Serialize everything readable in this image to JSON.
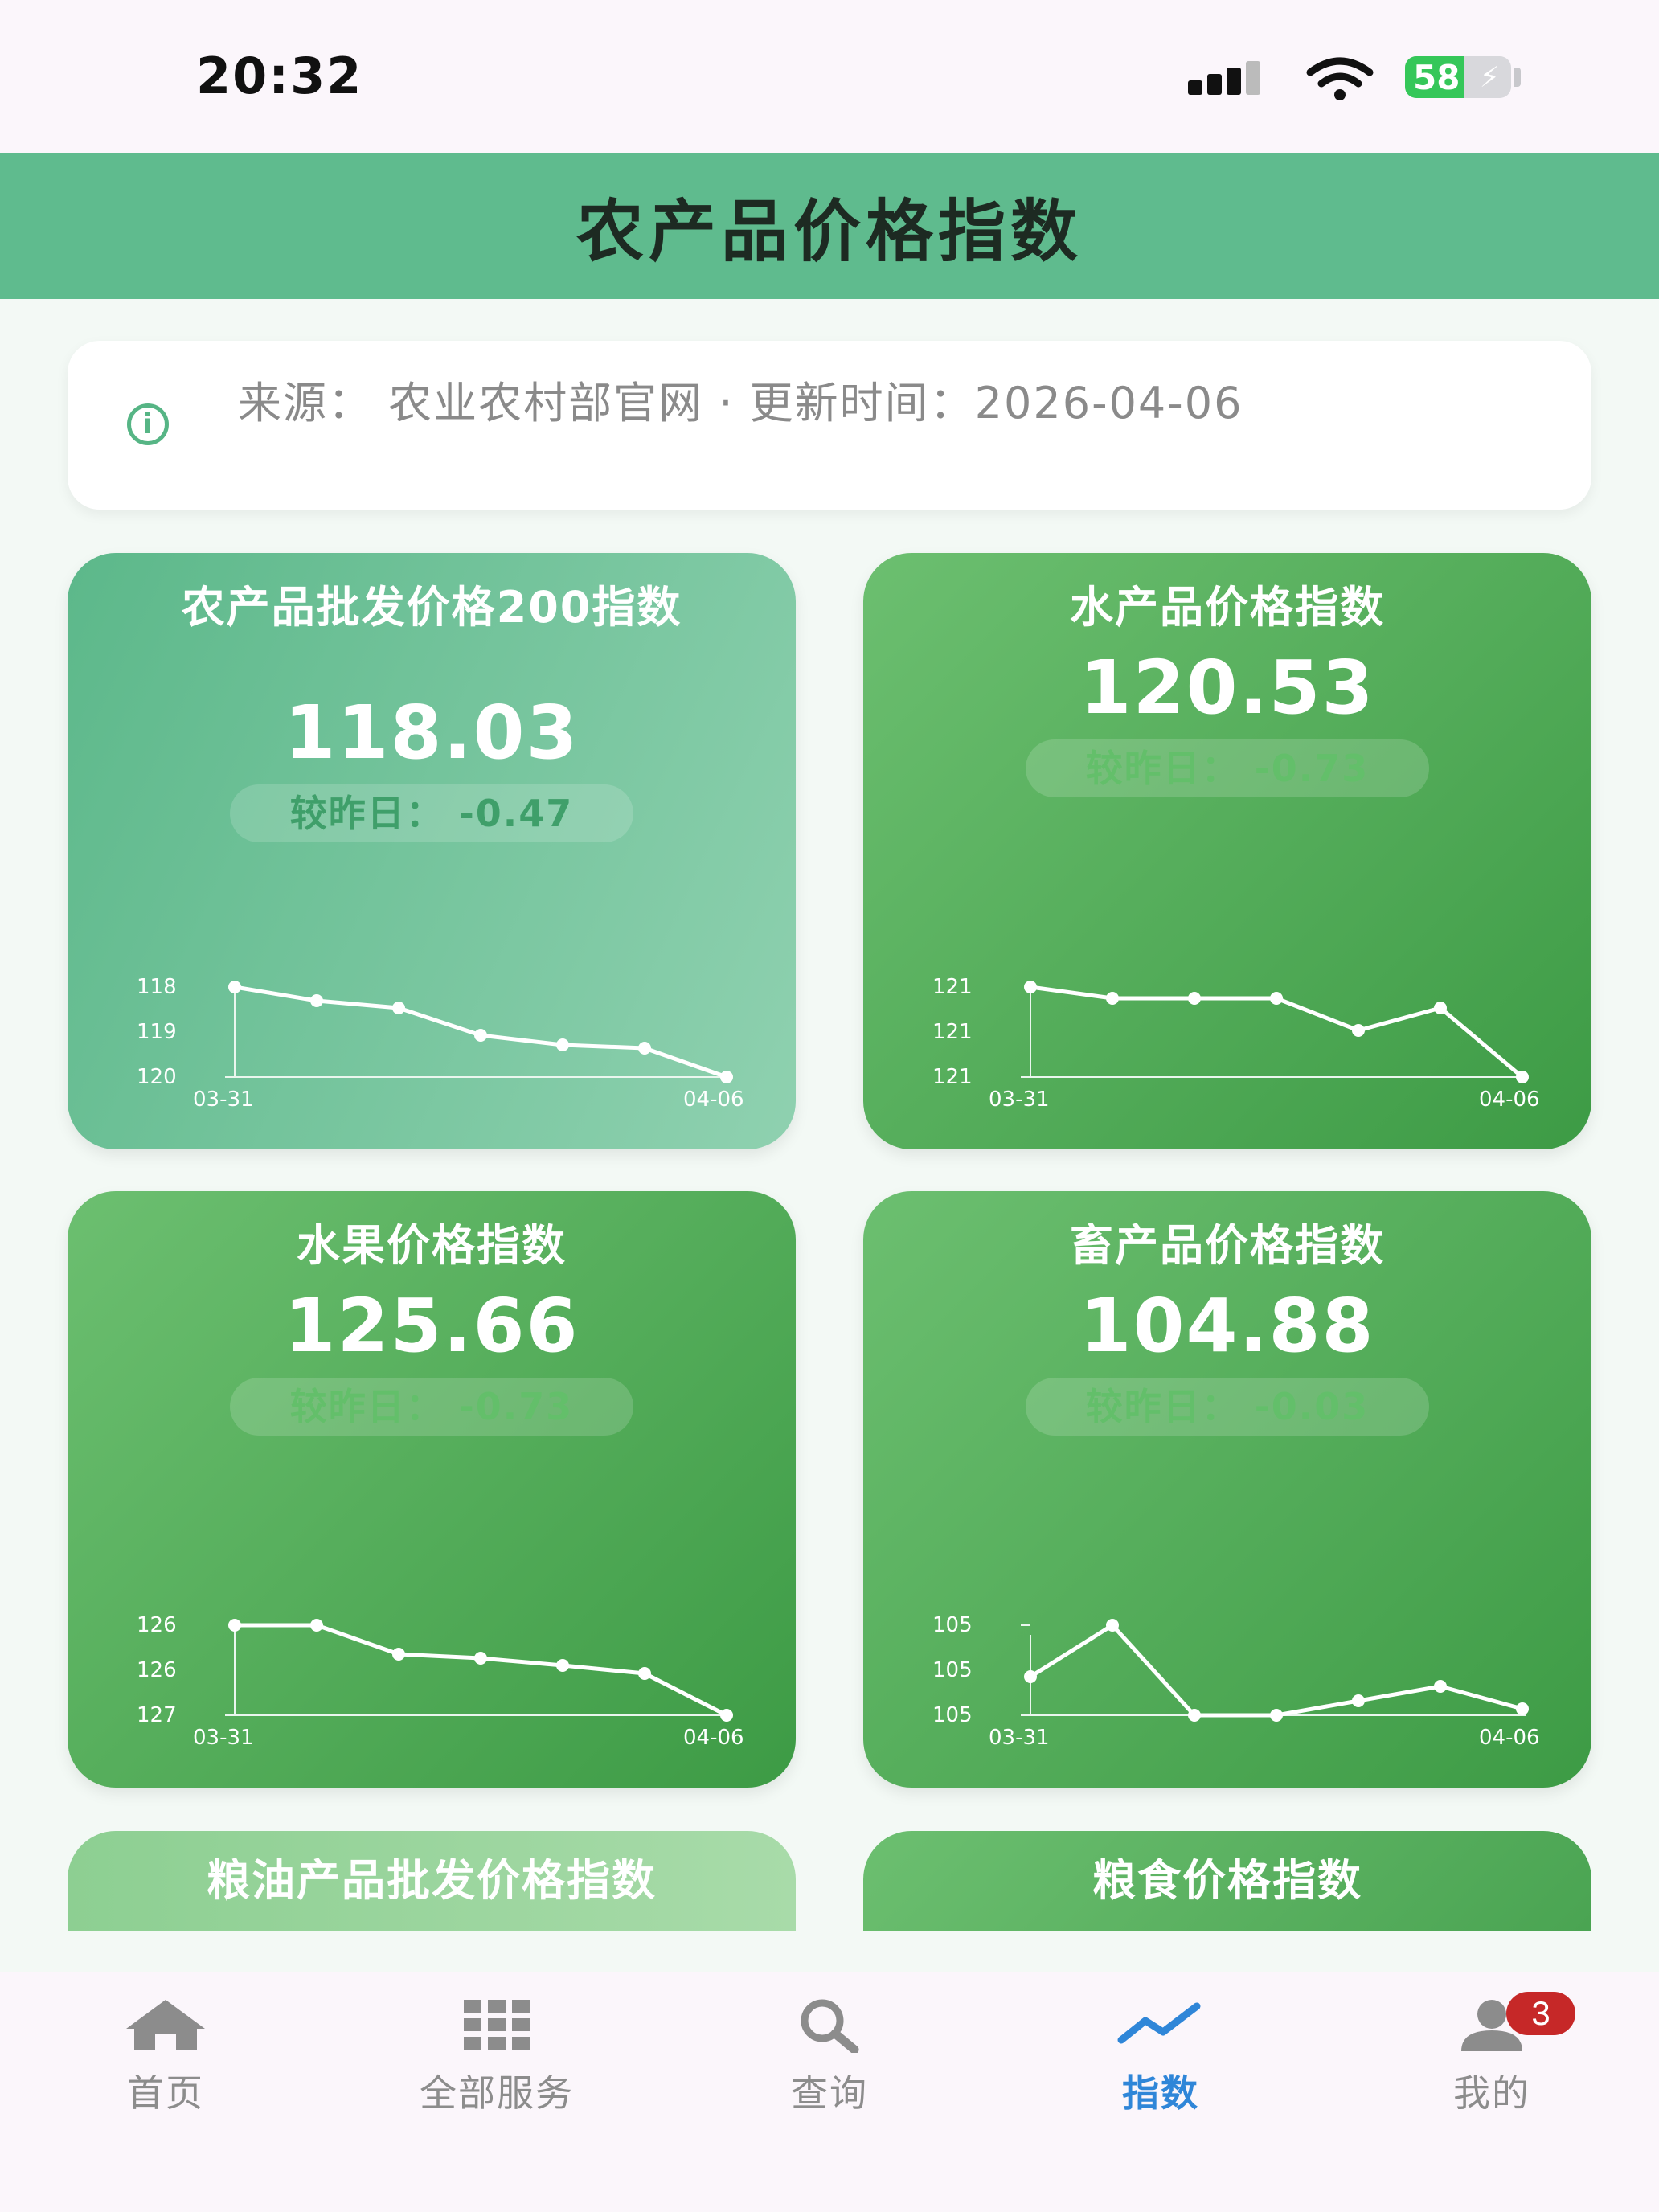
{
  "status_bar": {
    "time": "20:32",
    "battery": "58"
  },
  "header": {
    "title": "农产品价格指数"
  },
  "info": {
    "text": "来源： 农业农村部官网 · 更新时间：2026-04-06"
  },
  "cards": [
    {
      "title": "农产品批发价格200指数",
      "value": "118.03",
      "change": "较昨日： -0.47",
      "y_labels": [
        "118",
        "119",
        "120"
      ],
      "x_start": "03-31",
      "x_end": "04-06"
    },
    {
      "title": "水产品价格指数",
      "value": "120.53",
      "change": "较昨日： -0.73",
      "y_labels": [
        "121",
        "121",
        "121"
      ],
      "x_start": "03-31",
      "x_end": "04-06"
    },
    {
      "title": "水果价格指数",
      "value": "125.66",
      "change": "较昨日： -0.73",
      "y_labels": [
        "126",
        "126",
        "127"
      ],
      "x_start": "03-31",
      "x_end": "04-06"
    },
    {
      "title": "畜产品价格指数",
      "value": "104.88",
      "change": "较昨日： -0.03",
      "y_labels": [
        "105",
        "105",
        "105"
      ],
      "x_start": "03-31",
      "x_end": "04-06"
    }
  ],
  "partial_cards": [
    {
      "title": "粮油产品批发价格指数"
    },
    {
      "title": "粮食价格指数"
    }
  ],
  "tabbar": {
    "items": [
      {
        "label": "首页",
        "icon": "home-icon"
      },
      {
        "label": "全部服务",
        "icon": "grid-icon"
      },
      {
        "label": "查询",
        "icon": "search-icon"
      },
      {
        "label": "指数",
        "icon": "trend-icon"
      },
      {
        "label": "我的",
        "icon": "user-icon"
      }
    ],
    "active": "指数",
    "badge": "3"
  },
  "colors": {
    "accent": "#5fbb8e",
    "active_tab": "#2f86d8",
    "badge": "#c62828"
  },
  "chart_data": [
    {
      "type": "line",
      "title": "农产品批发价格200指数",
      "x": [
        "03-31",
        "04-01",
        "04-02",
        "04-03",
        "04-04",
        "04-05",
        "04-06"
      ],
      "values": [
        118.0,
        118.35,
        118.5,
        119.05,
        119.25,
        119.3,
        120.0
      ],
      "ylim_inverted": [
        118,
        120
      ]
    },
    {
      "type": "line",
      "title": "水产品价格指数",
      "x": [
        "03-31",
        "04-01",
        "04-02",
        "04-03",
        "04-04",
        "04-05",
        "04-06"
      ],
      "values": [
        121.0,
        121.25,
        121.25,
        121.25,
        121.95,
        121.4,
        123.0
      ]
    },
    {
      "type": "line",
      "title": "水果价格指数",
      "x": [
        "03-31",
        "04-01",
        "04-02",
        "04-03",
        "04-04",
        "04-05",
        "04-06"
      ],
      "values": [
        126.0,
        126.0,
        126.6,
        126.7,
        126.85,
        127.0,
        127.65
      ]
    },
    {
      "type": "line",
      "title": "畜产品价格指数",
      "x": [
        "03-31",
        "04-01",
        "04-02",
        "04-03",
        "04-04",
        "04-05",
        "04-06"
      ],
      "values": [
        105.0,
        105.0,
        105.0,
        105.0,
        105.0,
        105.0,
        105.0
      ]
    }
  ]
}
